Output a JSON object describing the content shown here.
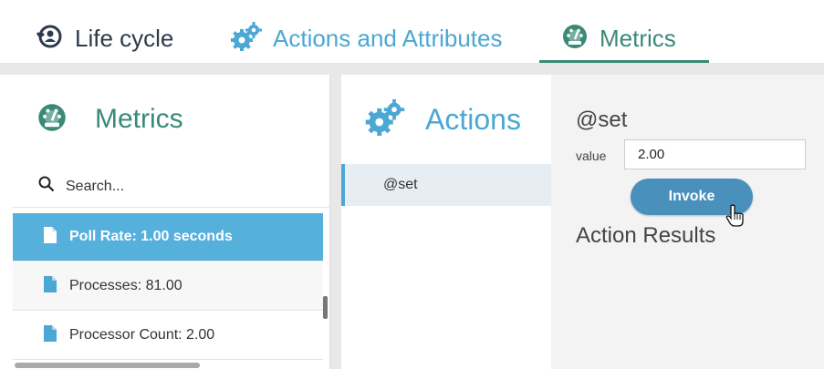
{
  "tabs": [
    {
      "label": "Life cycle",
      "icon": "lifecycle-icon",
      "color": "#2d3a4a"
    },
    {
      "label": "Actions and Attributes",
      "icon": "gears-icon",
      "color": "#4ba7d3"
    },
    {
      "label": "Metrics",
      "icon": "dashboard-icon",
      "color": "#3a8a76",
      "active": true
    }
  ],
  "metrics_panel": {
    "title": "Metrics",
    "icon": "dashboard-icon",
    "search_placeholder": "Search...",
    "items": [
      {
        "label": "Poll Rate: 1.00 seconds",
        "icon": "file-icon",
        "selected": true
      },
      {
        "label": "Processes: 81.00",
        "icon": "file-icon"
      },
      {
        "label": "Processor Count: 2.00",
        "icon": "file-icon"
      }
    ]
  },
  "actions_panel": {
    "title": "Actions",
    "icon": "gears-icon",
    "items": [
      {
        "label": "@set",
        "selected": true
      }
    ]
  },
  "action_detail": {
    "title": "@set",
    "value_label": "value",
    "value": "2.00",
    "invoke_label": "Invoke",
    "results_title": "Action Results"
  },
  "colors": {
    "accent_blue": "#4ba7d3",
    "accent_green": "#3a8a76",
    "selected_row": "#55b0dc",
    "invoke_button": "#4a90bd"
  }
}
